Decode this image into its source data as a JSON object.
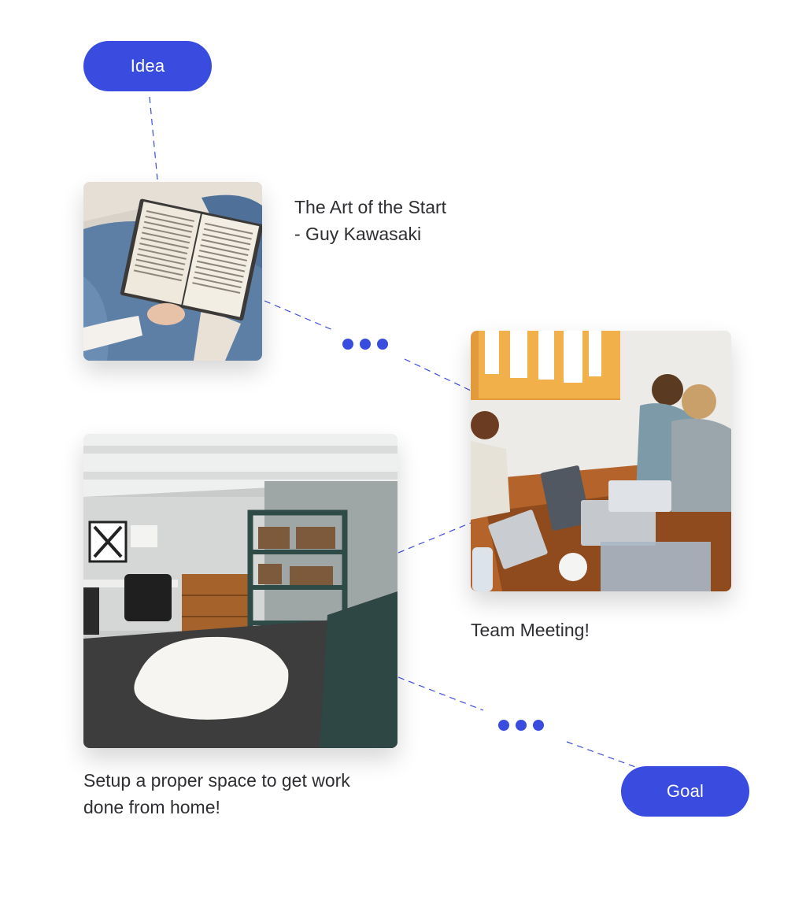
{
  "start_pill": {
    "label": "Idea"
  },
  "end_pill": {
    "label": "Goal"
  },
  "cards": [
    {
      "id": "book",
      "caption_lines": [
        "The Art of the Start",
        "- Guy Kawasaki"
      ]
    },
    {
      "id": "meeting",
      "caption_lines": [
        "Team Meeting!"
      ]
    },
    {
      "id": "office",
      "caption_lines": [
        "Setup a proper space to get work",
        "done from home!"
      ]
    }
  ],
  "colors": {
    "accent": "#3a4be0",
    "text": "#2f2f33",
    "background": "#ffffff"
  }
}
